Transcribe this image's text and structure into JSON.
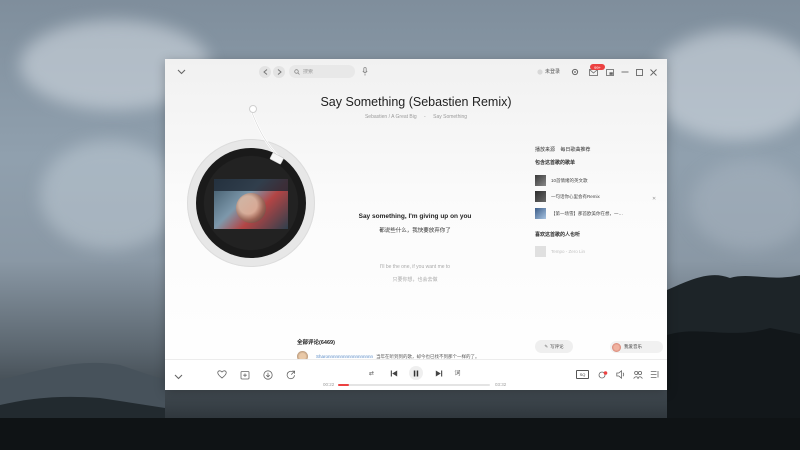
{
  "window": {
    "search_placeholder": "搜索",
    "login_label": "未登录",
    "mail_badge": "99+"
  },
  "song": {
    "title": "Say Something (Sebastien Remix)",
    "artist": "Sebastien / A Great Big",
    "album": "Say Something"
  },
  "lyrics": {
    "current_en": "Say something, I'm giving up on you",
    "current_cn": "都说些什么，我快要放弃你了",
    "next_en": "I'll be the one, if you want me to",
    "next_cn": "只要你想，也会去做"
  },
  "panel": {
    "tab_1": "播放来源",
    "tab_2": "每日歌曲推荐",
    "heading_playlists": "包含这首歌的歌单",
    "playlists": [
      "10首情绪的英文歌",
      "一句话你心里会有Remix",
      "【第一场雪】那首欧美你在想，一…"
    ],
    "heading_users": "喜欢这首歌的人也听",
    "user_song": "Tempo - Zero Lin",
    "write_comment": "写评论",
    "listener_name": "我爱音乐"
  },
  "comments": {
    "header": "全部评论(6469)",
    "first_user": "Sharonnnnnnnnnnnnnnnnnn",
    "first_text": "当年在听到到的歌，却今也已找不到那个一样的了。"
  },
  "player": {
    "current_time": "00:22",
    "total_time": "03:32",
    "progress": 0.07,
    "mode_label": "⇄",
    "lyric_label": "词",
    "quality_label": "SQ"
  },
  "colors": {
    "accent": "#ec4141",
    "comment_user": "#5b8cc7"
  }
}
